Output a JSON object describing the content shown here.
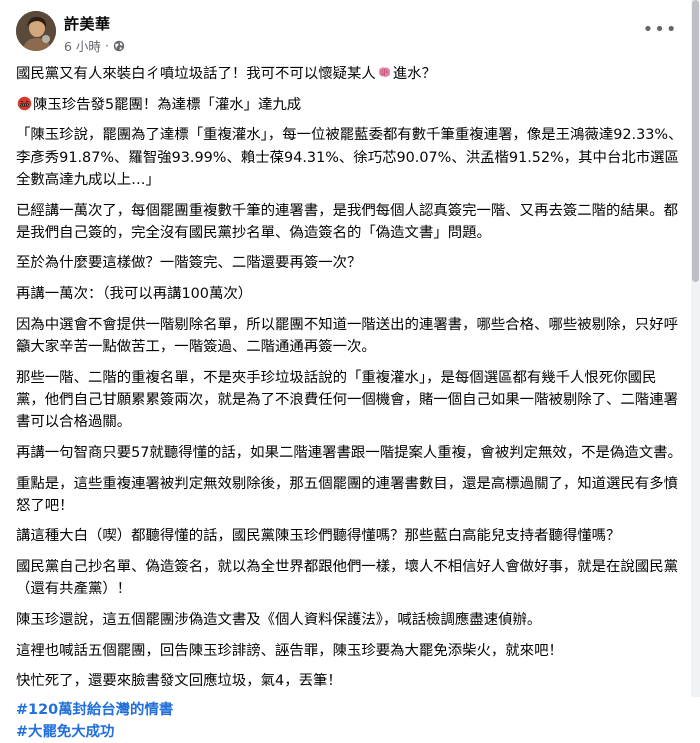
{
  "post": {
    "author": "許美華",
    "timestamp": "6 小時",
    "separator": "·",
    "privacy_icon": "globe-icon",
    "more_icon": "more-options-icon"
  },
  "paragraphs": {
    "p1a": "國民黨又有人來裝白ㄔ噴垃圾話了！我可不可以懷疑某人",
    "p1b": "進水？",
    "p2": "陳玉珍告發5罷團！為達標「灌水」達九成",
    "p3": "「陳玉珍說，罷團為了達標「重複灌水」，每一位被罷藍委都有數千筆重複連署，像是王鴻薇達92.33%、李彥秀91.87%、羅智強93.99%、賴士葆94.31%、徐巧芯90.07%、洪孟楷91.52%，其中台北市選區全數高達九成以上…」",
    "p4": "已經講一萬次了，每個罷團重複數千筆的連署書，是我們每個人認真簽完一階、又再去簽二階的結果。都是我們自己簽的，完全沒有國民黨抄名單、偽造簽名的「偽造文書」問題。",
    "p5": "至於為什麼要這樣做？一階簽完、二階還要再簽一次？",
    "p6": "再講一萬次：（我可以再講100萬次）",
    "p7": "因為中選會不會提供一階剔除名單，所以罷團不知道一階送出的連署書，哪些合格、哪些被剔除，只好呼籲大家辛苦一點做苦工，一階簽過、二階通通再簽一次。",
    "p8": "那些一階、二階的重複名單，不是夾手珍垃圾話說的「重複灌水」，是每個選區都有幾千人恨死你國民黨，他們自己甘願累累簽兩次，就是為了不浪費任何一個機會，賭一個自己如果一階被剔除了、二階連署書可以合格過關。",
    "p9": "再講一句智商只要57就聽得懂的話，如果二階連署書跟一階提案人重複，會被判定無效，不是偽造文書。",
    "p10": "重點是，這些重複連署被判定無效剔除後，那五個罷團的連署書數目，還是高標過關了，知道選民有多憤怒了吧！",
    "p11": "講這種大白（喫）都聽得懂的話，國民黨陳玉珍們聽得懂嗎？那些藍白高能兒支持者聽得懂嗎？",
    "p12": "國民黨自己抄名單、偽造簽名，就以為全世界都跟他們一樣，壞人不相信好人會做好事，就是在說國民黨（還有共產黨）！",
    "p13": "陳玉珍還說，這五個罷團涉偽造文書及《個人資料保護法》，喊話檢調應盡速偵辦。",
    "p14": "這裡也喊話五個罷團，回告陳玉珍誹謗、誣告罪，陳玉珍要為大罷免添柴火，就來吧！",
    "p15": "快忙死了，還要來臉書發文回應垃圾，氣4，丟筆！"
  },
  "hashtags": [
    "#120萬封給台灣的情書",
    "#大罷免大成功"
  ],
  "emojis": {
    "brain": "brain-emoji",
    "swearing": "face-with-symbols-emoji"
  },
  "colors": {
    "text": "#050505",
    "secondary": "#65676b",
    "hashtag": "#216fdb",
    "brain_pink": "#e67ea0",
    "angry_red": "#d83a2c"
  }
}
